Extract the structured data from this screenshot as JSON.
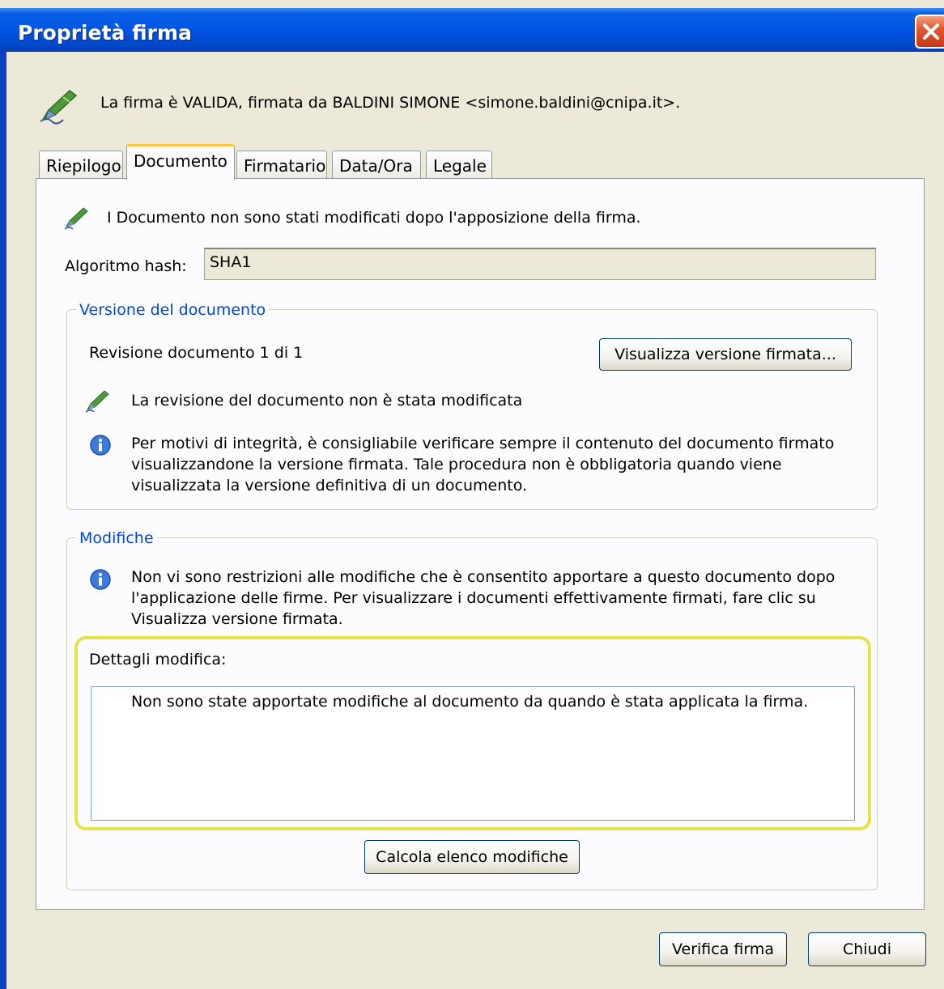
{
  "window": {
    "title": "Proprietà firma"
  },
  "header": {
    "status_text": "La firma è VALIDA, firmata da BALDINI SIMONE <simone.baldini@cnipa.it>."
  },
  "tabs": [
    {
      "label": "Riepilogo"
    },
    {
      "label": "Documento"
    },
    {
      "label": "Firmatario"
    },
    {
      "label": "Data/Ora"
    },
    {
      "label": "Legale"
    }
  ],
  "active_tab": "Documento",
  "document": {
    "not_modified_text": "I Documento non sono stati modificati dopo l'apposizione della firma.",
    "hash_label": "Algoritmo hash:",
    "hash_value": "SHA1"
  },
  "version_group": {
    "legend": "Versione del documento",
    "revision_text": "Revisione documento 1 di 1",
    "view_button": "Visualizza versione firmata...",
    "revision_status": "La revisione del documento non è stata modificata",
    "info_line1": "Per motivi di integrità, è consigliabile verificare sempre il contenuto del documento firmato",
    "info_line2": "visualizzandone la versione firmata. Tale procedura non è obbligatoria quando viene",
    "info_line3": "visualizzata la versione definitiva di un documento."
  },
  "changes_group": {
    "legend": "Modifiche",
    "info_line1": "Non vi sono restrizioni alle modifiche che è consentito apportare a questo documento dopo",
    "info_line2": "l'applicazione delle firme. Per visualizzare i documenti effettivamente firmati, fare clic su",
    "info_line3": "Visualizza versione firmata.",
    "details_label": "Dettagli modifica:",
    "details_text": "Non sono state apportate modifiche al documento da quando è stata applicata la firma.",
    "compute_button": "Calcola elenco modifiche"
  },
  "footer": {
    "verify_button": "Verifica firma",
    "close_button": "Chiudi"
  },
  "colors": {
    "titlebar": "#0054e3",
    "legend_text": "#0046d5",
    "highlight": "#e8e24a",
    "active_tab_accent": "#ffc83c"
  }
}
